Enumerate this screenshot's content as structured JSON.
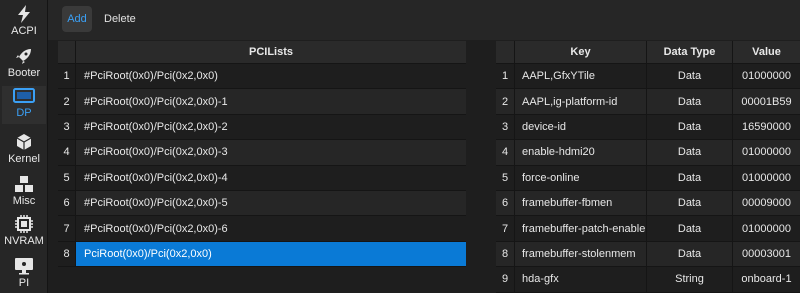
{
  "sidebar": {
    "items": [
      {
        "label": "ACPI",
        "icon": "lightning-icon"
      },
      {
        "label": "Booter",
        "icon": "rocket-icon"
      },
      {
        "label": "DP",
        "icon": "display-icon"
      },
      {
        "label": "Kernel",
        "icon": "cube-icon"
      },
      {
        "label": "Misc",
        "icon": "cubes-icon"
      },
      {
        "label": "NVRAM",
        "icon": "chip-icon"
      },
      {
        "label": "PI",
        "icon": "monitor-icon"
      }
    ],
    "active": "DP"
  },
  "toolbar": {
    "add_label": "Add",
    "delete_label": "Delete"
  },
  "pci_table": {
    "header": "PCILists",
    "rows": [
      {
        "n": "1",
        "value": "#PciRoot(0x0)/Pci(0x2,0x0)"
      },
      {
        "n": "2",
        "value": "#PciRoot(0x0)/Pci(0x2,0x0)-1"
      },
      {
        "n": "3",
        "value": "#PciRoot(0x0)/Pci(0x2,0x0)-2"
      },
      {
        "n": "4",
        "value": "#PciRoot(0x0)/Pci(0x2,0x0)-3"
      },
      {
        "n": "5",
        "value": "#PciRoot(0x0)/Pci(0x2,0x0)-4"
      },
      {
        "n": "6",
        "value": "#PciRoot(0x0)/Pci(0x2,0x0)-5"
      },
      {
        "n": "7",
        "value": "#PciRoot(0x0)/Pci(0x2,0x0)-6"
      },
      {
        "n": "8",
        "value": "PciRoot(0x0)/Pci(0x2,0x0)"
      }
    ],
    "selected_row": "8"
  },
  "props_table": {
    "headers": {
      "key": "Key",
      "type": "Data Type",
      "value": "Value"
    },
    "rows": [
      {
        "n": "1",
        "key": "AAPL,GfxYTile",
        "type": "Data",
        "value": "01000000"
      },
      {
        "n": "2",
        "key": "AAPL,ig-platform-id",
        "type": "Data",
        "value": "00001B59"
      },
      {
        "n": "3",
        "key": "device-id",
        "type": "Data",
        "value": "16590000"
      },
      {
        "n": "4",
        "key": "enable-hdmi20",
        "type": "Data",
        "value": "01000000"
      },
      {
        "n": "5",
        "key": "force-online",
        "type": "Data",
        "value": "01000000"
      },
      {
        "n": "6",
        "key": "framebuffer-fbmen",
        "type": "Data",
        "value": "00009000"
      },
      {
        "n": "7",
        "key": "framebuffer-patch-enable",
        "type": "Data",
        "value": "01000000"
      },
      {
        "n": "8",
        "key": "framebuffer-stolenmem",
        "type": "Data",
        "value": "00003001"
      },
      {
        "n": "9",
        "key": "hda-gfx",
        "type": "String",
        "value": "onboard-1"
      }
    ]
  },
  "colors": {
    "accent": "#3ba0f5",
    "selection": "#0a7ad6",
    "background": "#1e1e1e"
  }
}
